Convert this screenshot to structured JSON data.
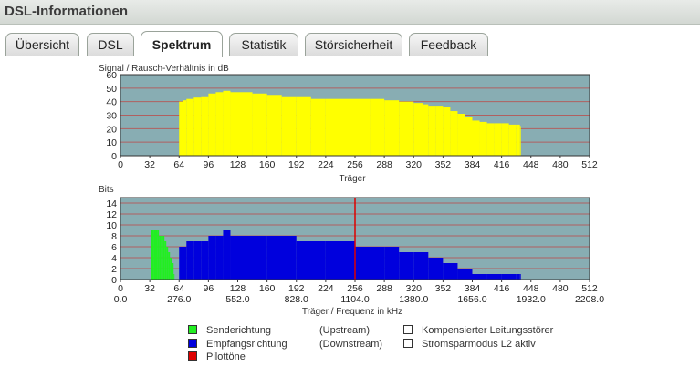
{
  "window": {
    "title": "DSL-Informationen"
  },
  "tabs": [
    {
      "label": "Übersicht",
      "active": false
    },
    {
      "label": "DSL",
      "active": false
    },
    {
      "label": "Spektrum",
      "active": true
    },
    {
      "label": "Statistik",
      "active": false
    },
    {
      "label": "Störsicherheit",
      "active": false
    },
    {
      "label": "Feedback",
      "active": false
    }
  ],
  "legend": {
    "sender": "Senderichtung",
    "sender_note": "(Upstream)",
    "receiver": "Empfangsrichtung",
    "receiver_note": "(Downstream)",
    "pilot": "Pilottöne",
    "compensated": "Kompensierter Leitungsstörer",
    "power_saving": "Stromsparmodus L2 aktiv"
  },
  "colors": {
    "plot_bg": "#88adb3",
    "gridline": "#b06060",
    "snr": "#ffff00",
    "upstream": "#22ee22",
    "downstream": "#0000dd",
    "pilot": "#dd0000"
  },
  "chart_data": [
    {
      "type": "bar",
      "title": "Signal / Rausch-Verhältnis in dB",
      "xlabel": "Träger",
      "xlim": [
        0,
        512
      ],
      "ylim": [
        0,
        60
      ],
      "xticks": [
        "0",
        "32",
        "64",
        "96",
        "128",
        "160",
        "192",
        "224",
        "256",
        "288",
        "320",
        "352",
        "384",
        "416",
        "448",
        "480",
        "512"
      ],
      "yticks": [
        "0",
        "10",
        "20",
        "30",
        "40",
        "50",
        "60"
      ],
      "grid": true,
      "series": [
        {
          "x": [
            64,
            68,
            72,
            80,
            88,
            96,
            104,
            112,
            120,
            128,
            144,
            160,
            176,
            192,
            208,
            224,
            240,
            256,
            272,
            288,
            304,
            320,
            330,
            336,
            344,
            352,
            360,
            368,
            376,
            384,
            392,
            400,
            408,
            416,
            424,
            432,
            436
          ],
          "y": [
            40,
            41,
            42,
            43,
            44,
            46,
            47,
            48,
            47,
            47,
            46,
            45,
            44,
            44,
            42,
            42,
            42,
            42,
            42,
            41,
            40,
            39,
            38,
            37,
            37,
            36,
            33,
            31,
            29,
            26,
            25,
            24,
            24,
            24,
            23,
            23,
            22
          ]
        }
      ]
    },
    {
      "type": "bar",
      "title": "Bits",
      "xlabel": "Träger / Frequenz in kHz",
      "xlim": [
        0,
        512
      ],
      "ylim": [
        0,
        15
      ],
      "xticks": [
        "0",
        "32",
        "64",
        "96",
        "128",
        "160",
        "192",
        "224",
        "256",
        "288",
        "320",
        "352",
        "384",
        "416",
        "448",
        "480",
        "512"
      ],
      "freq_ticks": [
        "0.0",
        "276.0",
        "552.0",
        "828.0",
        "1104.0",
        "1380.0",
        "1656.0",
        "1932.0",
        "2208.0"
      ],
      "yticks": [
        "0",
        "2",
        "4",
        "6",
        "8",
        "10",
        "12",
        "14"
      ],
      "grid": true,
      "series": [
        {
          "name": "Senderichtung",
          "x": [
            33,
            36,
            40,
            42,
            44,
            46,
            48,
            50,
            52,
            54,
            56,
            58
          ],
          "y": [
            9,
            9,
            9,
            8,
            8,
            8,
            7,
            6,
            5,
            4,
            3,
            1
          ]
        },
        {
          "name": "Empfangsrichtung",
          "x": [
            64,
            72,
            80,
            88,
            96,
            104,
            112,
            120,
            128,
            160,
            192,
            224,
            256,
            288,
            304,
            320,
            336,
            352,
            368,
            384,
            400,
            416,
            432,
            436
          ],
          "y": [
            6,
            7,
            7,
            7,
            8,
            8,
            9,
            8,
            8,
            8,
            7,
            7,
            6,
            6,
            5,
            5,
            4,
            3,
            2,
            1,
            1,
            1,
            1,
            1
          ]
        },
        {
          "name": "Pilottöne",
          "x": [
            256
          ],
          "y": [
            15
          ]
        }
      ]
    }
  ]
}
